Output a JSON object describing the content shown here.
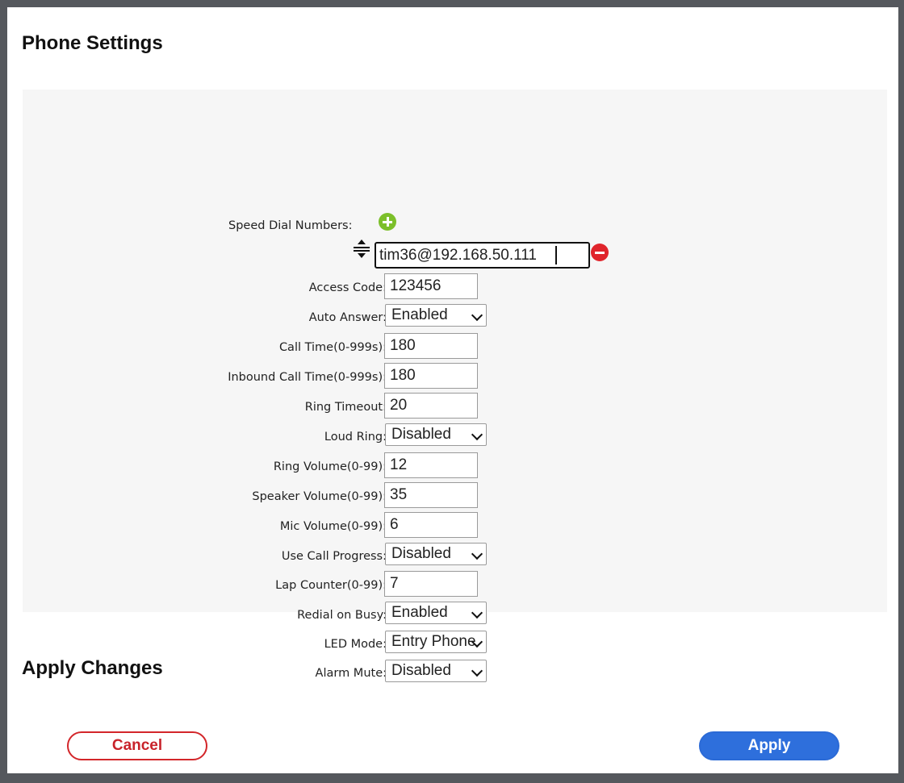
{
  "page": {
    "title": "Phone Settings"
  },
  "speed_dial": {
    "label": "Speed Dial Numbers:",
    "add_icon": "plus-circle-icon",
    "remove_icon": "minus-circle-icon",
    "drag_icon": "drag-handle-icon",
    "entries": [
      "tim36@192.168.50.111"
    ]
  },
  "settings": {
    "access_code": {
      "label": "Access Code:",
      "value": "123456"
    },
    "auto_answer": {
      "label": "Auto Answer:",
      "value": "Enabled"
    },
    "call_time": {
      "label": "Call Time(0-999s):",
      "value": "180"
    },
    "inbound_call_time": {
      "label": "Inbound Call Time(0-999s):",
      "value": "180"
    },
    "ring_timeout": {
      "label": "Ring Timeout:",
      "value": "20"
    },
    "loud_ring": {
      "label": "Loud Ring:",
      "value": "Disabled"
    },
    "ring_volume": {
      "label": "Ring Volume(0-99):",
      "value": "12"
    },
    "speaker_volume": {
      "label": "Speaker Volume(0-99):",
      "value": "35"
    },
    "mic_volume": {
      "label": "Mic Volume(0-99):",
      "value": "6"
    },
    "use_call_progress": {
      "label": "Use Call Progress:",
      "value": "Disabled"
    },
    "lap_counter": {
      "label": "Lap Counter(0-99):",
      "value": "7"
    },
    "redial_on_busy": {
      "label": "Redial on Busy:",
      "value": "Enabled"
    },
    "led_mode": {
      "label": "LED Mode:",
      "value": "Entry Phone"
    },
    "alarm_mute": {
      "label": "Alarm Mute:",
      "value": "Disabled"
    }
  },
  "apply_section": {
    "title": "Apply Changes",
    "cancel_label": "Cancel",
    "apply_label": "Apply"
  },
  "colors": {
    "add": "#7cbf2a",
    "remove": "#e0252c",
    "cancel": "#d3262a",
    "apply": "#2e6fdc",
    "panel_bg": "#f6f6f6"
  }
}
